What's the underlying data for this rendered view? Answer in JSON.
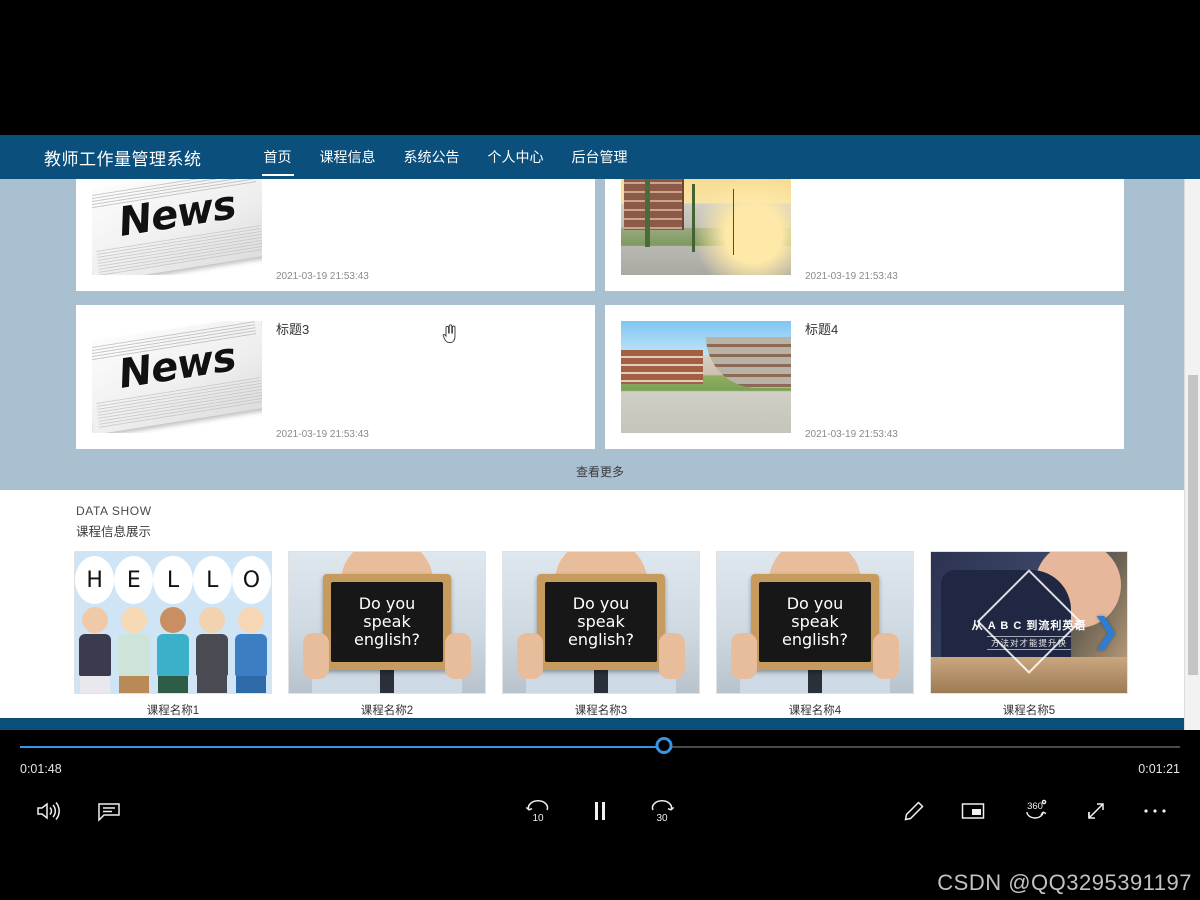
{
  "player": {
    "time_elapsed": "0:01:48",
    "time_remaining": "0:01:21",
    "progress_percent": 55.5,
    "accent_color": "#3a95e0",
    "watermark": "CSDN @QQ3295391197",
    "left_controls": [
      {
        "name": "volume-icon",
        "label": "Volume"
      },
      {
        "name": "captions-icon",
        "label": "Captions"
      }
    ],
    "center_controls": [
      {
        "name": "rewind-10-icon",
        "label": "10"
      },
      {
        "name": "pause-icon",
        "label": "Pause"
      },
      {
        "name": "forward-30-icon",
        "label": "30"
      }
    ],
    "right_controls": [
      {
        "name": "draw-icon",
        "label": "Draw"
      },
      {
        "name": "mini-player-icon",
        "label": "Mini player"
      },
      {
        "name": "vr-360-icon",
        "label": "360"
      },
      {
        "name": "fullscreen-icon",
        "label": "Fullscreen"
      },
      {
        "name": "more-options-icon",
        "label": "More"
      }
    ]
  },
  "site": {
    "brand": "教师工作量管理系统",
    "nav": [
      {
        "label": "首页",
        "active": true
      },
      {
        "label": "课程信息",
        "active": false
      },
      {
        "label": "系统公告",
        "active": false
      },
      {
        "label": "个人中心",
        "active": false
      },
      {
        "label": "后台管理",
        "active": false
      }
    ],
    "nav_bg": "#0b4f7d",
    "page_bg": "#a9c0d0",
    "news": [
      {
        "title": "",
        "date": "2021-03-19 21:53:43",
        "thumb": "newspaper",
        "clipped": true
      },
      {
        "title": "",
        "date": "2021-03-19 21:53:43",
        "thumb": "campus-sunset",
        "clipped": true
      },
      {
        "title": "标题3",
        "date": "2021-03-19 21:53:43",
        "thumb": "newspaper",
        "clipped": false
      },
      {
        "title": "标题4",
        "date": "2021-03-19 21:53:43",
        "thumb": "campus-courtyard",
        "clipped": false
      }
    ],
    "view_more": "查看更多",
    "data_show": {
      "title_en": "DATA SHOW",
      "title_cn": "课程信息展示",
      "next_arrow": "❯"
    },
    "courses": [
      {
        "name": "课程名称1",
        "art": "hello",
        "letters": [
          "H",
          "E",
          "L",
          "L",
          "O"
        ]
      },
      {
        "name": "课程名称2",
        "art": "blackboard",
        "board_lines": [
          "Do you",
          "speak",
          "english?"
        ]
      },
      {
        "name": "课程名称3",
        "art": "blackboard",
        "board_lines": [
          "Do you",
          "speak",
          "english?"
        ]
      },
      {
        "name": "课程名称4",
        "art": "blackboard",
        "board_lines": [
          "Do you",
          "speak",
          "english?"
        ]
      },
      {
        "name": "课程名称5",
        "art": "abc",
        "headline": "从 A B C 到流利英语",
        "subline": "方法对才能提升快"
      }
    ]
  }
}
